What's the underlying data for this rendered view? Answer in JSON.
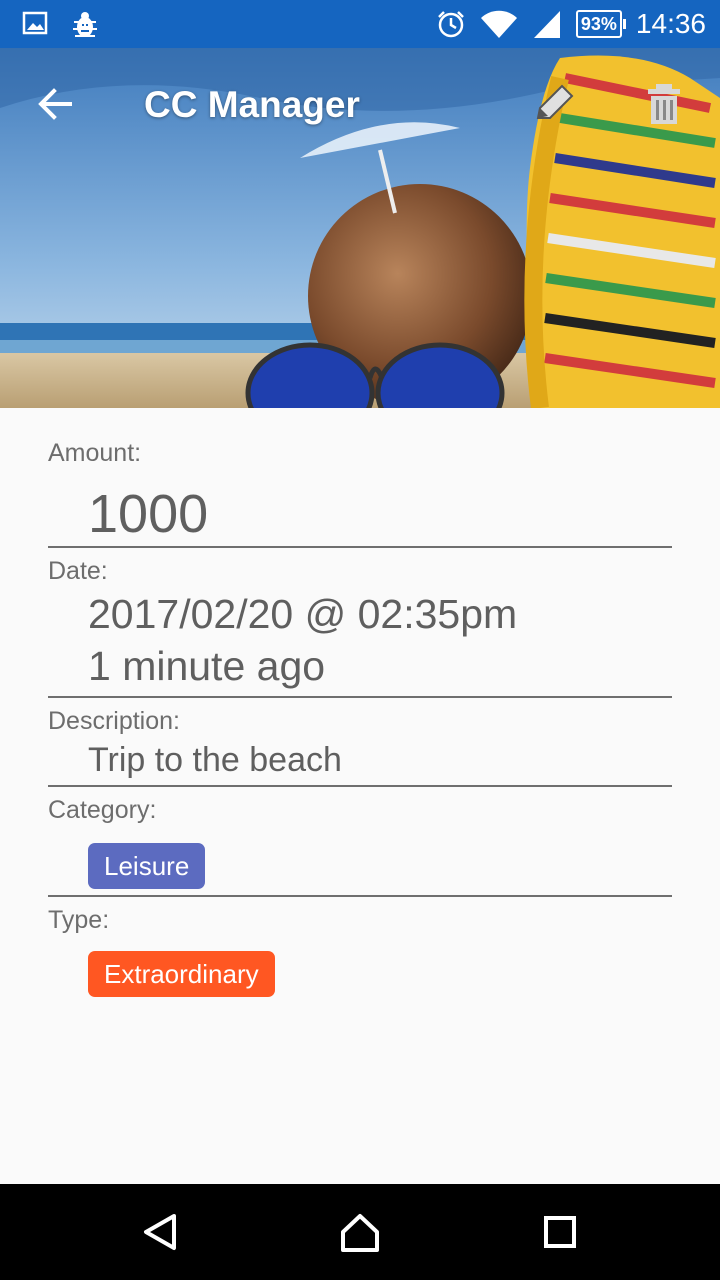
{
  "status_bar": {
    "battery": "93%",
    "time": "14:36",
    "icons": [
      "gallery-icon",
      "bug-icon",
      "alarm-icon",
      "wifi-icon",
      "signal-icon",
      "battery-icon"
    ]
  },
  "toolbar": {
    "title": "CC Manager",
    "icons": [
      "back-arrow-icon",
      "edit-pencil-icon",
      "trash-icon"
    ]
  },
  "fields": {
    "amount": {
      "label": "Amount:",
      "value": "1000"
    },
    "date": {
      "label": "Date:",
      "value": "2017/02/20 @ 02:35pm",
      "relative": "1 minute ago"
    },
    "description": {
      "label": "Description:",
      "value": "Trip to the beach"
    },
    "category": {
      "label": "Category:",
      "tag": "Leisure",
      "color": "#5c6bc0"
    },
    "type": {
      "label": "Type:",
      "tag": "Extraordinary",
      "color": "#ff5722"
    }
  },
  "nav": {
    "icons": [
      "back-triangle-icon",
      "home-icon",
      "recents-square-icon"
    ]
  },
  "colors": {
    "status_bar": "#1565c0",
    "background": "#fafafa"
  }
}
